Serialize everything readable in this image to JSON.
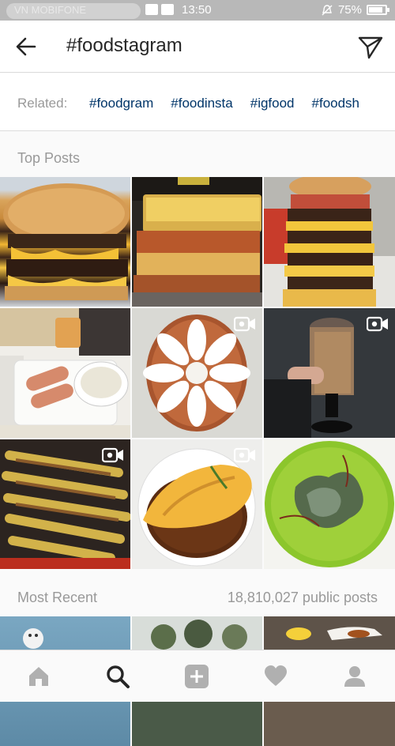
{
  "status_bar": {
    "carrier": "VN MOBIFONE",
    "time": "13:50",
    "battery_percent": "75%",
    "battery_level": 0.75
  },
  "header": {
    "title": "#foodstagram"
  },
  "related": {
    "label": "Related:",
    "tags": [
      "#foodgram",
      "#foodinsta",
      "#igfood",
      "#foodsh"
    ]
  },
  "top_posts": {
    "label": "Top Posts",
    "posts": [
      {
        "description": "cheeseburger",
        "video": false
      },
      {
        "description": "grilled cheese sandwich",
        "video": false
      },
      {
        "description": "tall burger stack",
        "video": false
      },
      {
        "description": "wraps with dip",
        "video": false
      },
      {
        "description": "flower pie",
        "video": true
      },
      {
        "description": "cake",
        "video": true
      },
      {
        "description": "skewers",
        "video": true
      },
      {
        "description": "omelette",
        "video": true
      },
      {
        "description": "green soup",
        "video": false
      }
    ]
  },
  "most_recent": {
    "label": "Most Recent",
    "count": "18,810,027 public posts"
  },
  "colors": {
    "tag_blue": "#003569",
    "muted": "#999999",
    "text": "#262626"
  },
  "icons": {
    "back": "arrow-left-icon",
    "share": "paper-plane-icon",
    "home": "home-icon",
    "search": "search-icon",
    "add": "plus-square-icon",
    "activity": "heart-icon",
    "profile": "person-icon"
  }
}
